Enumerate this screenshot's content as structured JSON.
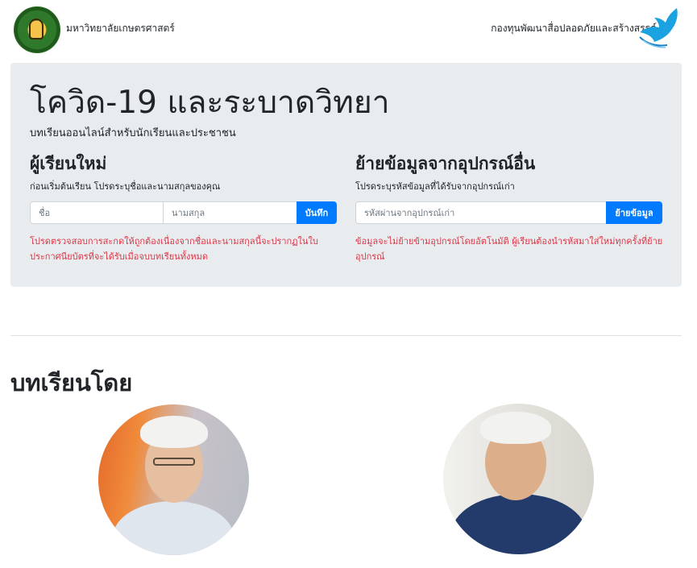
{
  "header": {
    "university_name": "มหาวิทยาลัยเกษตรศาสตร์",
    "organization_name": "กองทุนพัฒนาสื่อปลอดภัยและสร้างสรรค์",
    "left_logo_icon": "kasetsart-university-seal-icon",
    "right_logo_icon": "blue-bird-logo-icon"
  },
  "hero": {
    "title": "โควิด-19 และระบาดวิทยา",
    "subtitle": "บทเรียนออนไลน์สำหรับนักเรียนและประชาชน"
  },
  "new_learner": {
    "heading": "ผู้เรียนใหม่",
    "description": "ก่อนเริ่มต้นเรียน โปรดระบุชื่อและนามสกุลของคุณ",
    "first_name_placeholder": "ชื่อ",
    "last_name_placeholder": "นามสกุล",
    "save_label": "บันทึก",
    "warning": "โปรดตรวจสอบการสะกดให้ถูกต้องเนื่องจากชื่อและนามสกุลนี้จะปรากฏในใบประกาศนียบัตรที่จะได้รับเมื่อจบบทเรียนทั้งหมด"
  },
  "transfer": {
    "heading": "ย้ายข้อมูลจากอุปกรณ์อื่น",
    "description": "โปรดระบุรหัสข้อมูลที่ได้รับจากอุปกรณ์เก่า",
    "code_placeholder": "รหัสผ่านจากอุปกรณ์เก่า",
    "transfer_label": "ย้ายข้อมูล",
    "warning": "ข้อมูลจะไม่ย้ายข้ามอุปกรณ์โดยอัตโนมัติ ผู้เรียนต้องนำรหัสมาใส่ใหม่ทุกครั้งที่ย้ายอุปกรณ์"
  },
  "lessons_by": {
    "heading": "บทเรียนโดย"
  },
  "colors": {
    "accent": "#007bff",
    "warning": "#dc3545",
    "panel_bg": "#e9ecef"
  }
}
